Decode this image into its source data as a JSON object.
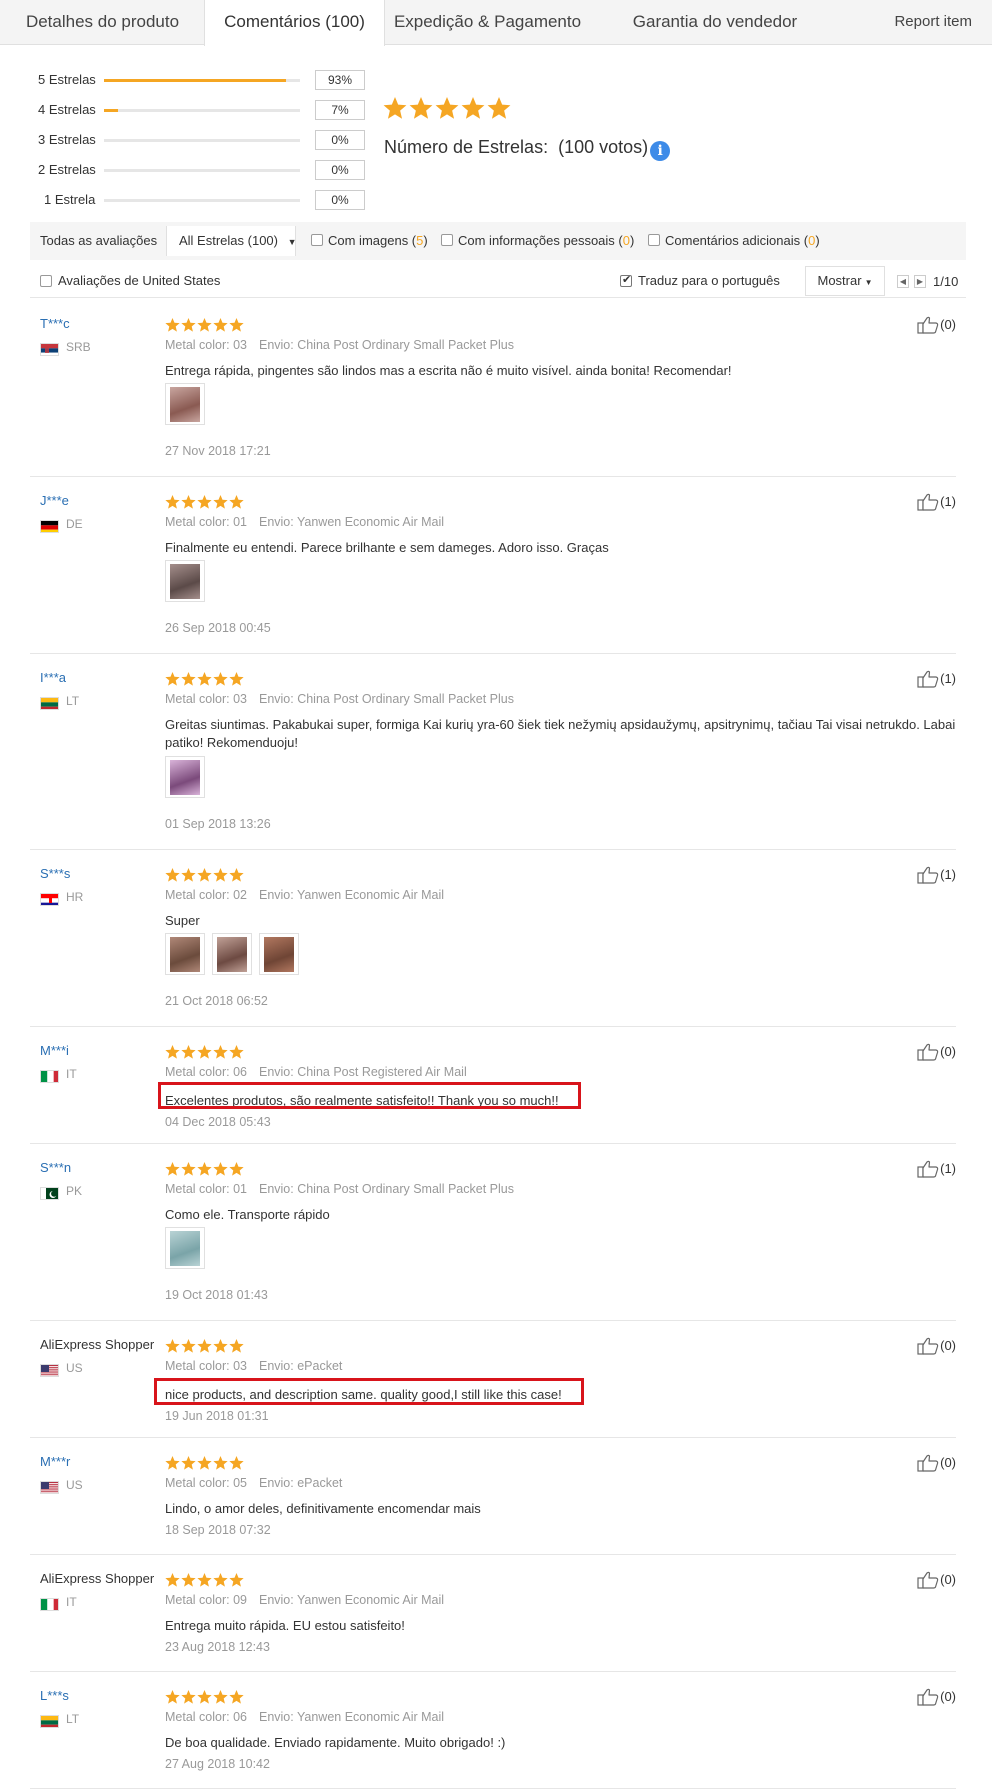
{
  "tabs": [
    {
      "label": "Detalhes do produto"
    },
    {
      "label": "Comentários (100)"
    },
    {
      "label": "Expedição & Pagamento"
    },
    {
      "label": "Garantia do vendedor"
    }
  ],
  "report_label": "Report item",
  "rating": {
    "distribution": [
      {
        "label": "5 Estrelas",
        "percent": "93%",
        "fraction": 0.93
      },
      {
        "label": "4 Estrelas",
        "percent": "7%",
        "fraction": 0.07
      },
      {
        "label": "3 Estrelas",
        "percent": "0%",
        "fraction": 0
      },
      {
        "label": "2 Estrelas",
        "percent": "0%",
        "fraction": 0
      },
      {
        "label": "1 Estrela",
        "percent": "0%",
        "fraction": 0
      }
    ],
    "stars": 5,
    "title": "Número de Estrelas:",
    "votes": "(100 votos)",
    "info_icon": "i"
  },
  "filters": {
    "all_label": "Todas as avaliações",
    "select_value": "All Estrelas (100)",
    "with_images": {
      "label": "Com imagens (",
      "count": "5",
      "close": ")"
    },
    "with_personal": {
      "label": "Com informações pessoais (",
      "count": "0",
      "close": ")"
    },
    "additional": {
      "label": "Comentários adicionais (",
      "count": "0",
      "close": ")"
    },
    "us_reviews": "Avaliações de United States",
    "translate": "Traduz para o português",
    "show": "Mostrar",
    "page": "1/10"
  },
  "colors": {
    "accent_orange": "#f5a623",
    "link_blue": "#2a6fb3",
    "highlight_red": "#d8141b",
    "info_blue": "#3d8be8"
  },
  "reviews": [
    {
      "user": "T***c",
      "country": "SRB",
      "flag": "rs",
      "metal": "Metal color: 03",
      "shipping": "Envio: China Post Ordinary Small Packet Plus",
      "text": "Entrega rápida, pingentes são lindos mas a escrita não é muito visível. ainda bonita! Recomendar!",
      "date": "27 Nov 2018 17:21",
      "likes": "(0)",
      "images": 1
    },
    {
      "user": "J***e",
      "country": "DE",
      "flag": "de",
      "metal": "Metal color: 01",
      "shipping": "Envio: Yanwen Economic Air Mail",
      "text": "Finalmente eu entendi. Parece brilhante e sem dameges. Adoro isso. Graças",
      "date": "26 Sep 2018 00:45",
      "likes": "(1)",
      "images": 1
    },
    {
      "user": "I***a",
      "country": "LT",
      "flag": "lt",
      "metal": "Metal color: 03",
      "shipping": "Envio: China Post Ordinary Small Packet Plus",
      "text": "Greitas siuntimas. Pakabukai super, formiga Kai kurių yra-60 šiek tiek nežymių apsidaužymų, apsitrynimų, tačiau Tai visai netrukdo. Labai patiko! Rekomenduoju!",
      "date": "01 Sep 2018 13:26",
      "likes": "(1)",
      "images": 1
    },
    {
      "user": "S***s",
      "country": "HR",
      "flag": "hr",
      "metal": "Metal color: 02",
      "shipping": "Envio: Yanwen Economic Air Mail",
      "text": "Super",
      "date": "21 Oct 2018 06:52",
      "likes": "(1)",
      "images": 3
    },
    {
      "user": "M***i",
      "country": "IT",
      "flag": "it",
      "metal": "Metal color: 06",
      "shipping": "Envio: China Post Registered Air Mail",
      "text": "Excelentes produtos, são realmente satisfeito!! Thank you so much!!",
      "date": "04 Dec 2018 05:43",
      "likes": "(0)",
      "images": 0
    },
    {
      "user": "S***n",
      "country": "PK",
      "flag": "pk",
      "metal": "Metal color: 01",
      "shipping": "Envio: China Post Ordinary Small Packet Plus",
      "text": "Como ele. Transporte rápido",
      "date": "19 Oct 2018 01:43",
      "likes": "(1)",
      "images": 1
    },
    {
      "user": "AliExpress Shopper",
      "country": "US",
      "flag": "us",
      "metal": "Metal color: 03",
      "shipping": "Envio: ePacket",
      "text": "nice products, and description same. quality good,I still like this case!",
      "date": "19 Jun 2018 01:31",
      "likes": "(0)",
      "images": 0
    },
    {
      "user": "M***r",
      "country": "US",
      "flag": "us",
      "metal": "Metal color: 05",
      "shipping": "Envio: ePacket",
      "text": "Lindo, o amor deles, definitivamente encomendar mais",
      "date": "18 Sep 2018 07:32",
      "likes": "(0)",
      "images": 0
    },
    {
      "user": "AliExpress Shopper",
      "country": "IT",
      "flag": "it",
      "metal": "Metal color: 09",
      "shipping": "Envio: Yanwen Economic Air Mail",
      "text": "Entrega muito rápida. EU estou satisfeito!",
      "date": "23 Aug 2018 12:43",
      "likes": "(0)",
      "images": 0
    },
    {
      "user": "L***s",
      "country": "LT",
      "flag": "lt",
      "metal": "Metal color: 06",
      "shipping": "Envio: Yanwen Economic Air Mail",
      "text": "De boa qualidade. Enviado rapidamente. Muito obrigado! :)",
      "date": "27 Aug 2018 10:42",
      "likes": "(0)",
      "images": 0
    }
  ]
}
